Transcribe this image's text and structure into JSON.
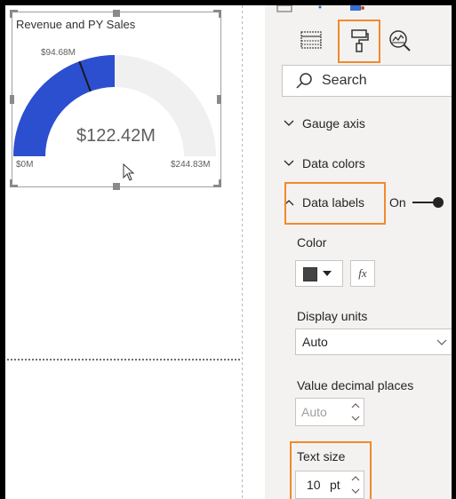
{
  "visual": {
    "title": "Revenue and PY Sales",
    "value_label": "$122.42M",
    "min_label": "$0M",
    "max_label": "$244.83M",
    "target_label": "$94.68M",
    "value": 122.42,
    "max": 244.83,
    "target": 94.68,
    "fill_color": "#2c4fd0",
    "track_color": "#f0f0f0"
  },
  "pane": {
    "tabs": [
      {
        "name": "fields",
        "icon": "table-icon"
      },
      {
        "name": "format",
        "icon": "paint-roller-icon"
      },
      {
        "name": "analytics",
        "icon": "magnifier-chart-icon"
      }
    ],
    "search_placeholder": "Search",
    "sections": {
      "gauge_axis": "Gauge axis",
      "data_colors": "Data colors",
      "data_labels": "Data labels",
      "data_labels_toggle": "On"
    },
    "color_label": "Color",
    "color_value": "#444444",
    "fx_label": "fx",
    "display_units_label": "Display units",
    "display_units_value": "Auto",
    "decimal_label": "Value decimal places",
    "decimal_placeholder": "Auto",
    "text_size_label": "Text size",
    "text_size_value": "10",
    "text_size_unit": "pt"
  },
  "colors": {
    "highlight": "#f28a2b"
  }
}
